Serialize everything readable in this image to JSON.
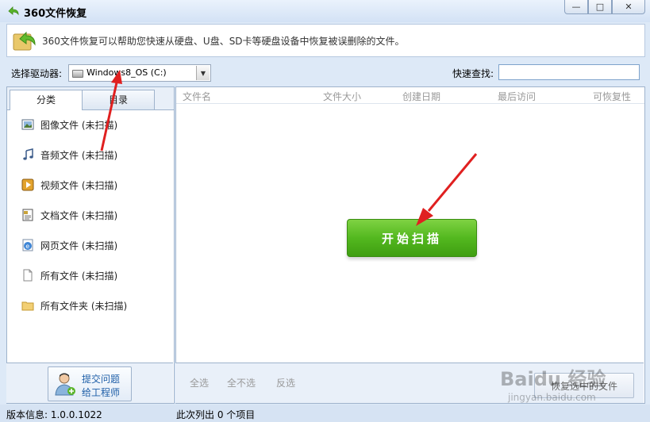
{
  "window": {
    "title": "360文件恢复",
    "controls": {
      "minimize": "—",
      "maximize": "□",
      "close": "✕"
    }
  },
  "banner": {
    "text": "360文件恢复可以帮助您快速从硬盘、U盘、SD卡等硬盘设备中恢复被误删除的文件。",
    "icon": "green-arrow-restore-icon"
  },
  "toolbar": {
    "drive_label": "选择驱动器:",
    "drive_value": "Windows8_OS (C:)",
    "quick_search_label": "快速查找:",
    "quick_search_value": ""
  },
  "tabs": [
    {
      "label": "分类"
    },
    {
      "label": "目录"
    }
  ],
  "categories": [
    {
      "label": "图像文件 (未扫描)",
      "icon": "image-icon"
    },
    {
      "label": "音频文件 (未扫描)",
      "icon": "music-note-icon"
    },
    {
      "label": "视频文件 (未扫描)",
      "icon": "video-icon"
    },
    {
      "label": "文档文件 (未扫描)",
      "icon": "document-icon"
    },
    {
      "label": "网页文件 (未扫描)",
      "icon": "ie-globe-icon"
    },
    {
      "label": "所有文件 (未扫描)",
      "icon": "blank-file-icon"
    },
    {
      "label": "所有文件夹 (未扫描)",
      "icon": "folder-icon"
    }
  ],
  "support": {
    "line1": "提交问题",
    "line2": "给工程师"
  },
  "columns": [
    "文件名",
    "文件大小",
    "创建日期",
    "最后访问",
    "可恢复性"
  ],
  "scan_button": "开始扫描",
  "selection": {
    "all": "全选",
    "none": "全不选",
    "invert": "反选"
  },
  "restore_button": "恢复选中的文件",
  "status": {
    "version": "版本信息: 1.0.0.1022",
    "count": "此次列出 0 个项目"
  },
  "watermark": {
    "main": "Baidu 经验",
    "sub": "jingyan.baidu.com"
  }
}
